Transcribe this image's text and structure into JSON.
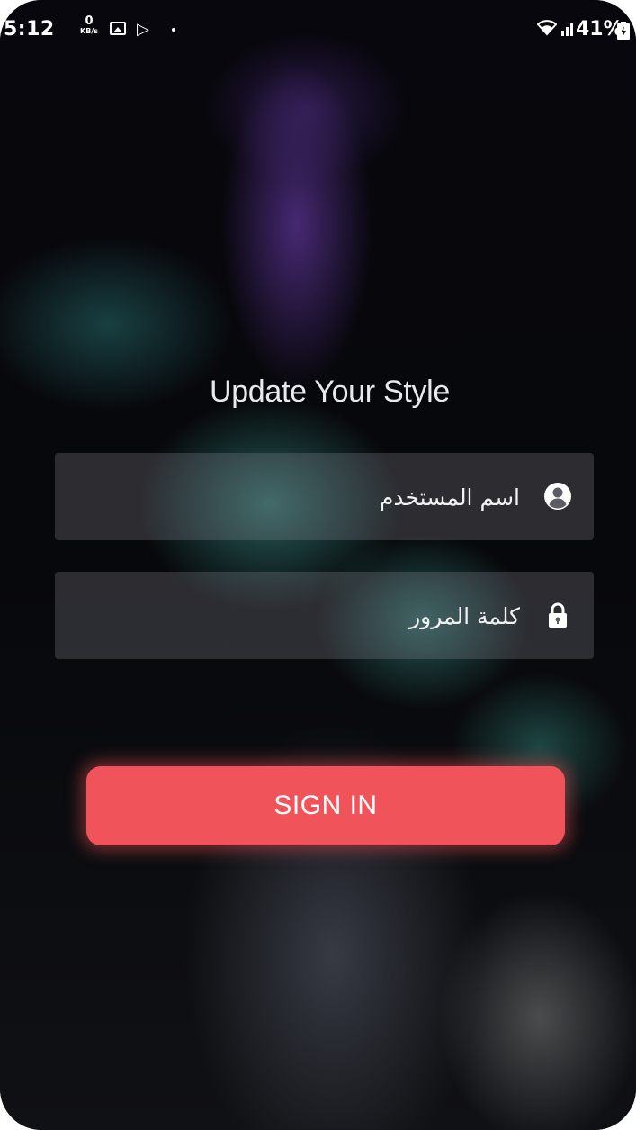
{
  "status_bar": {
    "time": "5:12",
    "net_speed_value": "0",
    "net_speed_unit": "KB/s",
    "battery_percent": "41%",
    "icons": [
      "gallery-icon",
      "play-store-icon",
      "wifi-icon",
      "signal-icon",
      "battery-charging-icon"
    ]
  },
  "login": {
    "title": "Update Your Style",
    "username_placeholder": "اسم المستخدم",
    "password_placeholder": "كلمة المرور",
    "signin_label": "SIGN IN",
    "username_icon": "user-circle-icon",
    "password_icon": "lock-icon"
  },
  "colors": {
    "accent": "#f0545a",
    "field_background": "#8c8c96",
    "text": "#ffffff"
  }
}
